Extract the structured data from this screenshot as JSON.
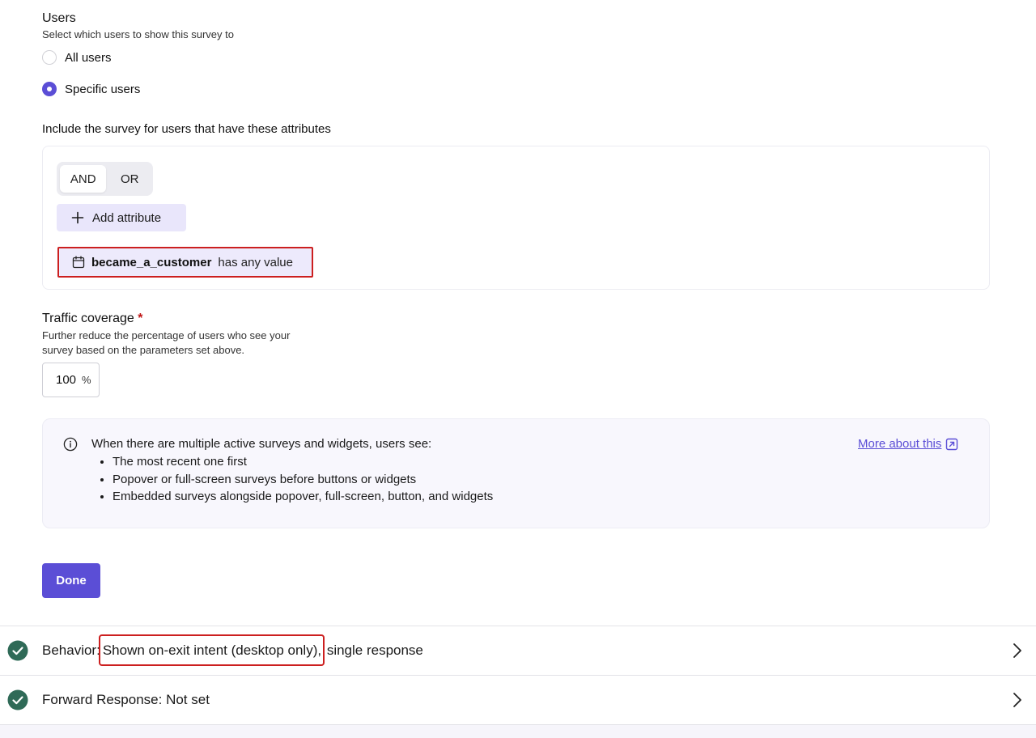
{
  "users": {
    "title": "Users",
    "subtitle": "Select which users to show this survey to",
    "options": [
      {
        "label": "All users",
        "checked": false
      },
      {
        "label": "Specific users",
        "checked": true
      }
    ]
  },
  "attributes": {
    "label": "Include the survey for users that have these attributes",
    "logic": {
      "and_label": "AND",
      "or_label": "OR",
      "selected": "AND"
    },
    "add_label": "Add attribute",
    "filter": {
      "icon": "calendar-icon",
      "name": "became_a_customer",
      "condition": "has any value"
    }
  },
  "traffic": {
    "title": "Traffic coverage",
    "required_mark": "*",
    "description": "Further reduce the percentage of users who see your survey based on the parameters set above.",
    "value": "100",
    "unit": "%"
  },
  "info": {
    "icon": "info-icon",
    "heading": "When there are multiple active surveys and widgets, users see:",
    "items": [
      "The most recent one first",
      "Popover or full-screen surveys before buttons or widgets",
      "Embedded surveys alongside popover, full-screen, button, and widgets"
    ],
    "link_label": "More about this",
    "link_icon": "external-link-icon"
  },
  "done_label": "Done",
  "sections": [
    {
      "title": "Behavior:",
      "value_highlight": "Shown on-exit intent (desktop only),",
      "value_rest": " single response",
      "status_icon": "check-circle-icon"
    },
    {
      "title": "Forward Response:",
      "value": " Not set",
      "status_icon": "check-circle-icon"
    }
  ],
  "colors": {
    "accent": "#5b4ed6",
    "accent_light": "#e9e6fb",
    "success": "#2f6a57",
    "highlight_border": "#cc1f1f",
    "required": "#c01515"
  }
}
